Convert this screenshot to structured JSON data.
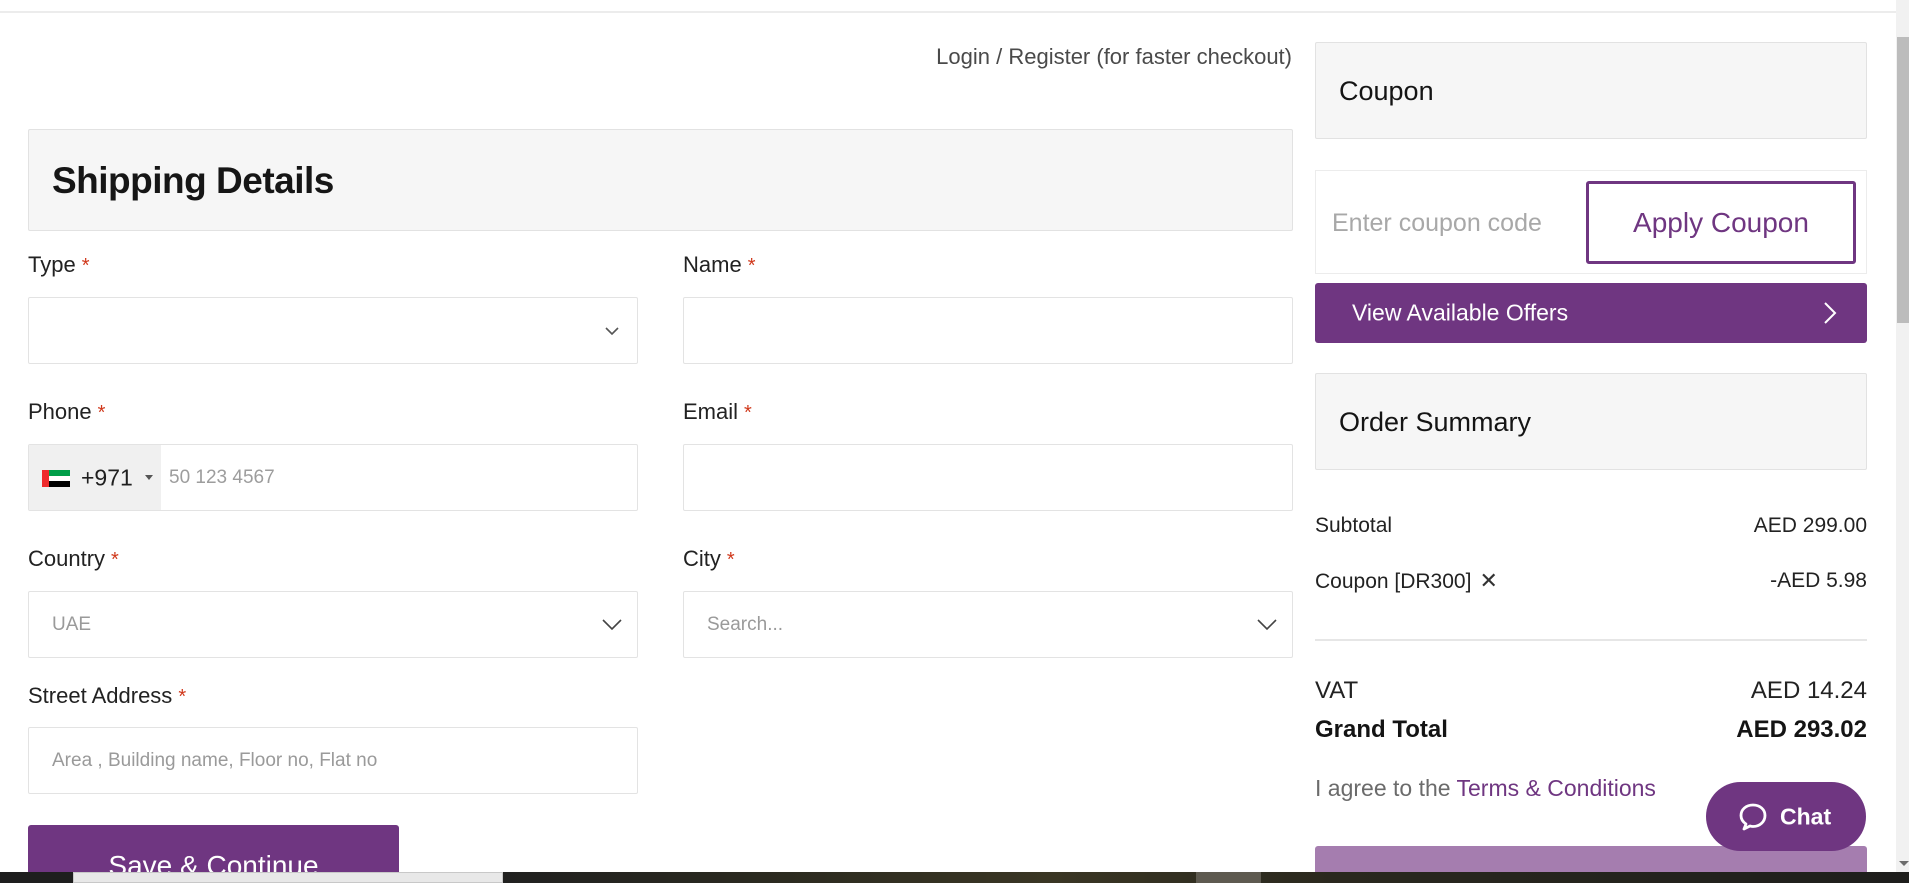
{
  "header": {
    "login_link": "Login / Register (for faster checkout)"
  },
  "shipping": {
    "title": "Shipping Details",
    "required_mark": "*",
    "fields": {
      "type": {
        "label": "Type",
        "value": "",
        "placeholder": ""
      },
      "name": {
        "label": "Name",
        "value": "",
        "placeholder": ""
      },
      "phone": {
        "label": "Phone",
        "country_flag": "uae-flag-icon",
        "country_code": "+971",
        "placeholder": "50 123 4567"
      },
      "email": {
        "label": "Email",
        "value": "",
        "placeholder": ""
      },
      "country": {
        "label": "Country",
        "value": "UAE"
      },
      "city": {
        "label": "City",
        "placeholder": "Search..."
      },
      "street": {
        "label": "Street Address",
        "placeholder": "Area , Building name, Floor no, Flat no"
      }
    },
    "save_button": "Save & Continue"
  },
  "coupon": {
    "title": "Coupon",
    "input_placeholder": "Enter coupon code",
    "apply_button": "Apply Coupon",
    "offers_button": "View Available Offers"
  },
  "summary": {
    "title": "Order Summary",
    "subtotal_label": "Subtotal",
    "subtotal_value": "AED 299.00",
    "coupon_label": "Coupon [DR300]",
    "coupon_remove": "✕",
    "coupon_value": "-AED 5.98",
    "vat_label": "VAT",
    "vat_value": "AED 14.24",
    "grand_label": "Grand Total",
    "grand_value": "AED 293.02",
    "agree_prefix": "I agree to the ",
    "terms_link": "Terms & Conditions"
  },
  "chat": {
    "label": "Chat"
  },
  "colors": {
    "brand": "#6f3681",
    "brand_disabled": "#a57daf",
    "required": "#d0381b",
    "panel_bg": "#f6f6f6"
  }
}
